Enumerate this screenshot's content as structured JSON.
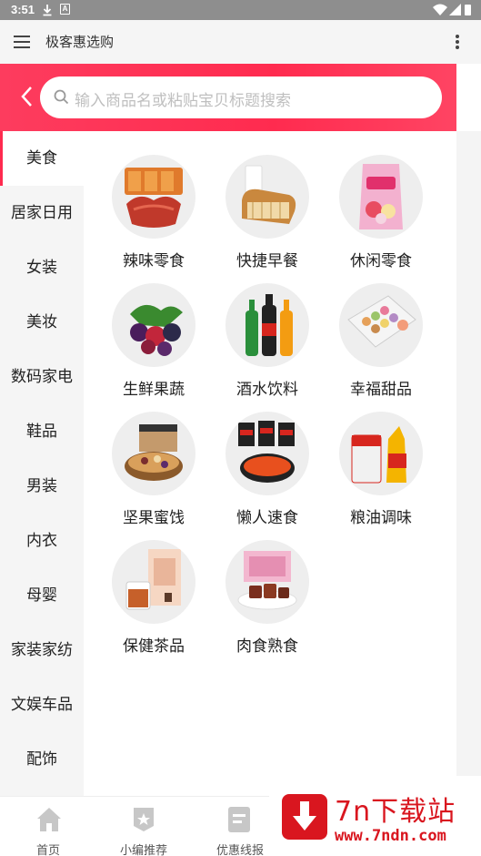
{
  "status_bar": {
    "time": "3:51",
    "icons": [
      "download-icon",
      "a-badge-icon",
      "wifi-icon",
      "signal-icon",
      "battery-icon"
    ],
    "a_badge": "A"
  },
  "app_bar": {
    "title": "极客惠选购",
    "icons": [
      "menu-icon",
      "more-vert-icon"
    ]
  },
  "search": {
    "placeholder": "输入商品名或粘贴宝贝标题搜索",
    "accent_color": "#ff2b4f"
  },
  "sidebar": {
    "items": [
      {
        "label": "美食",
        "active": true
      },
      {
        "label": "居家日用",
        "active": false
      },
      {
        "label": "女装",
        "active": false
      },
      {
        "label": "美妆",
        "active": false
      },
      {
        "label": "数码家电",
        "active": false
      },
      {
        "label": "鞋品",
        "active": false
      },
      {
        "label": "男装",
        "active": false
      },
      {
        "label": "内衣",
        "active": false
      },
      {
        "label": "母婴",
        "active": false
      },
      {
        "label": "家装家纺",
        "active": false
      },
      {
        "label": "文娱车品",
        "active": false
      },
      {
        "label": "配饰",
        "active": false
      }
    ]
  },
  "categories": [
    {
      "label": "辣味零食",
      "icon": "spicy-snack-icon"
    },
    {
      "label": "快捷早餐",
      "icon": "bread-milk-icon"
    },
    {
      "label": "休闲零食",
      "icon": "chips-bag-icon"
    },
    {
      "label": "生鲜果蔬",
      "icon": "berries-icon"
    },
    {
      "label": "酒水饮料",
      "icon": "soda-bottles-icon"
    },
    {
      "label": "幸福甜品",
      "icon": "macaron-box-icon"
    },
    {
      "label": "坚果蜜饯",
      "icon": "nuts-bowl-icon"
    },
    {
      "label": "懒人速食",
      "icon": "instant-noodles-icon"
    },
    {
      "label": "粮油调味",
      "icon": "rice-oil-icon"
    },
    {
      "label": "保健茶品",
      "icon": "tea-box-icon"
    },
    {
      "label": "肉食熟食",
      "icon": "jerky-icon"
    }
  ],
  "bottom_nav": {
    "items": [
      {
        "label": "首页",
        "icon": "home-icon"
      },
      {
        "label": "小编推荐",
        "icon": "badge-star-icon"
      },
      {
        "label": "优惠线报",
        "icon": "document-icon"
      }
    ]
  },
  "watermark": {
    "brand": "7n下载站",
    "url": "www.7ndn.com",
    "color": "#d9161f"
  }
}
